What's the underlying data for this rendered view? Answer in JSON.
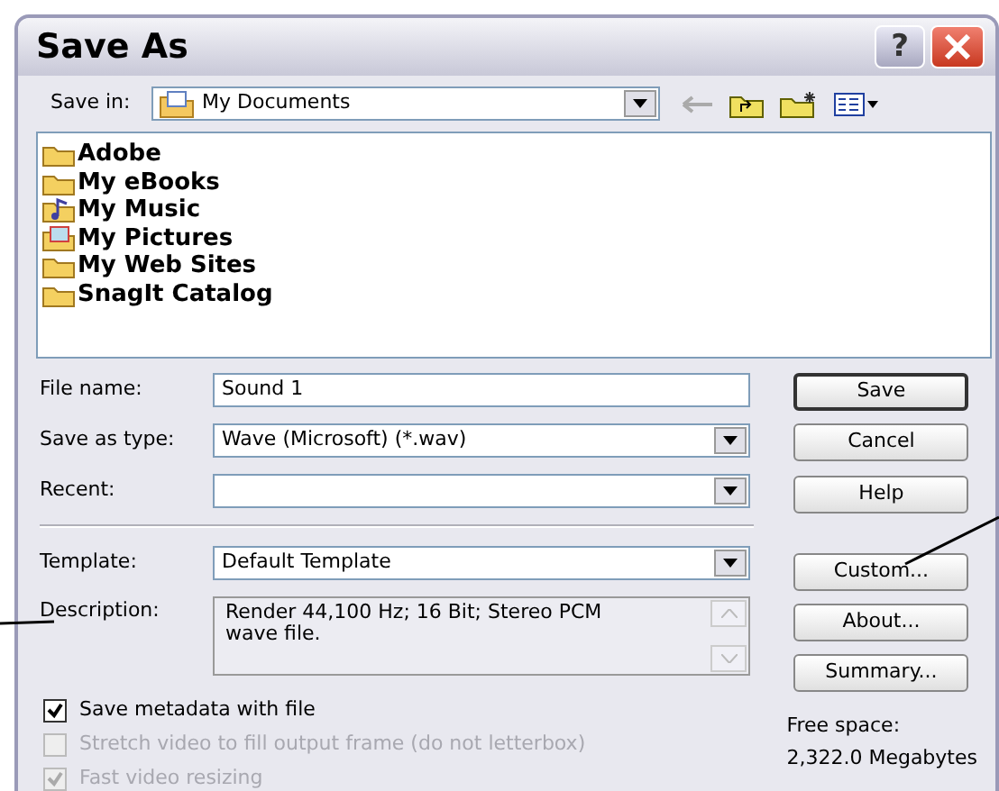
{
  "window": {
    "title": "Save As",
    "help_button": "?"
  },
  "save_in": {
    "label": "Save in:",
    "value": "My Documents"
  },
  "files": [
    {
      "name": "Adobe",
      "kind": "folder"
    },
    {
      "name": "My eBooks",
      "kind": "folder"
    },
    {
      "name": "My Music",
      "kind": "music"
    },
    {
      "name": "My Pictures",
      "kind": "pictures"
    },
    {
      "name": "My Web Sites",
      "kind": "folder"
    },
    {
      "name": "SnagIt Catalog",
      "kind": "folder"
    }
  ],
  "fields": [
    {
      "label": "File name:",
      "value": "Sound 1",
      "kind": "text"
    },
    {
      "label": "Save as type:",
      "value": "Wave (Microsoft) (*.wav)",
      "kind": "combo"
    },
    {
      "label": "Recent:",
      "kind": "combo"
    }
  ],
  "template": {
    "label": "Template:",
    "value": "Default Template"
  },
  "description": {
    "label": "Description:",
    "value": "Render 44,100 Hz; 16 Bit; Stereo PCM wave file."
  },
  "buttons": [
    {
      "label": "Save",
      "default": true
    },
    {
      "label": "Cancel",
      "default": false
    },
    {
      "label": "Help",
      "default": false
    },
    {
      "label": "Custom...",
      "default": false
    },
    {
      "label": "About...",
      "default": false
    },
    {
      "label": "Summary...",
      "default": false
    }
  ],
  "options": [
    {
      "label": "Save metadata with file",
      "checked": true,
      "disabled": false
    },
    {
      "label": "Stretch video to fill output frame (do not letterbox)",
      "checked": false,
      "disabled": true
    },
    {
      "label": "Fast video resizing",
      "checked": true,
      "disabled": true
    }
  ],
  "free_space": {
    "label": "Free space:",
    "value": "2,322.0 Megabytes"
  }
}
